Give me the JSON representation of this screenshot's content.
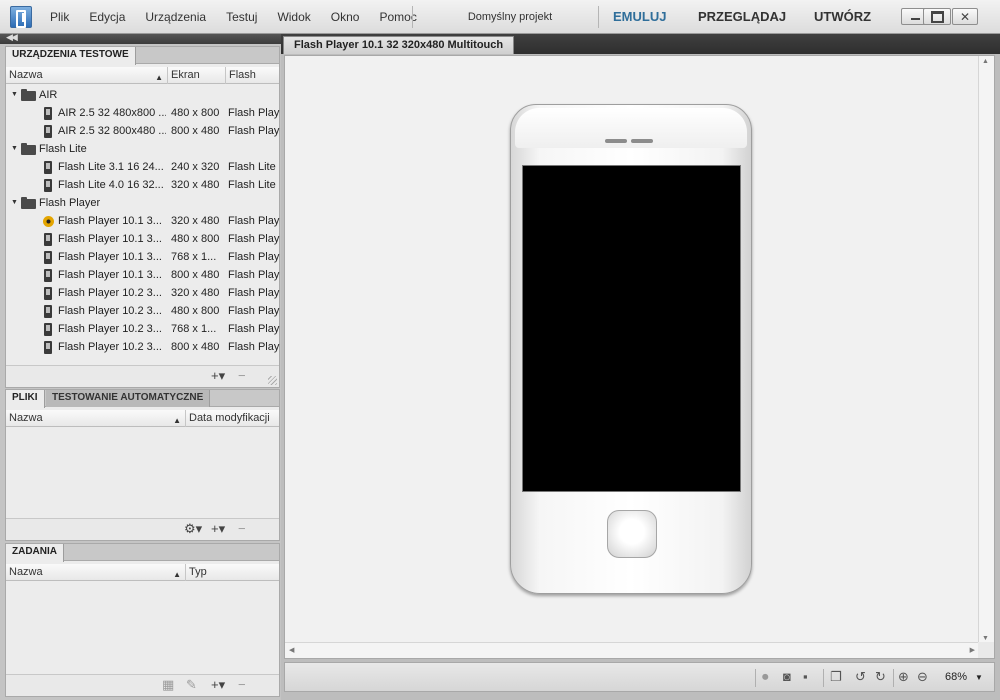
{
  "menu": [
    "Plik",
    "Edycja",
    "Urządzenia",
    "Testuj",
    "Widok",
    "Okno",
    "Pomoc"
  ],
  "project": "Domyślny projekt",
  "workspaces": [
    {
      "label": "EMULUJ",
      "active": true
    },
    {
      "label": "PRZEGLĄDAJ",
      "active": false
    },
    {
      "label": "UTWÓRZ",
      "active": false
    }
  ],
  "devices_panel": {
    "tab": "URZĄDZENIA TESTOWE",
    "columns": [
      "Nazwa",
      "Ekran",
      "Flash"
    ],
    "groups": [
      {
        "name": "AIR",
        "devices": [
          {
            "name": "AIR 2.5 32 480x800 ...",
            "screen": "480 x 800",
            "flash": "Flash Play"
          },
          {
            "name": "AIR 2.5 32 800x480 ...",
            "screen": "800 x 480",
            "flash": "Flash Play"
          }
        ]
      },
      {
        "name": "Flash Lite",
        "devices": [
          {
            "name": "Flash Lite 3.1 16 24...",
            "screen": "240 x 320",
            "flash": "Flash Lite"
          },
          {
            "name": "Flash Lite 4.0 16 32...",
            "screen": "320 x 480",
            "flash": "Flash Lite"
          }
        ]
      },
      {
        "name": "Flash Player",
        "devices": [
          {
            "name": "Flash Player 10.1 3...",
            "screen": "320 x 480",
            "flash": "Flash Play",
            "selected": true
          },
          {
            "name": "Flash Player 10.1 3...",
            "screen": "480 x 800",
            "flash": "Flash Play"
          },
          {
            "name": "Flash Player 10.1 3...",
            "screen": "768 x 1...",
            "flash": "Flash Play"
          },
          {
            "name": "Flash Player 10.1 3...",
            "screen": "800 x 480",
            "flash": "Flash Play"
          },
          {
            "name": "Flash Player 10.2 3...",
            "screen": "320 x 480",
            "flash": "Flash Play"
          },
          {
            "name": "Flash Player 10.2 3...",
            "screen": "480 x 800",
            "flash": "Flash Play"
          },
          {
            "name": "Flash Player 10.2 3...",
            "screen": "768 x 1...",
            "flash": "Flash Play"
          },
          {
            "name": "Flash Player 10.2 3...",
            "screen": "800 x 480",
            "flash": "Flash Play"
          }
        ]
      }
    ],
    "footer": {
      "add": "+▾",
      "remove": "−"
    }
  },
  "files_panel": {
    "tabs": [
      "PLIKI",
      "TESTOWANIE AUTOMATYCZNE"
    ],
    "columns": [
      "Nazwa",
      "Data modyfikacji"
    ],
    "footer": {
      "gear": "⚙▾",
      "add": "+▾",
      "remove": "−"
    }
  },
  "tasks_panel": {
    "tab": "ZADANIA",
    "columns": [
      "Nazwa",
      "Typ"
    ],
    "footer": {
      "add": "+▾",
      "remove": "−"
    }
  },
  "document": {
    "tab": "Flash Player 10.1 32 320x480 Multitouch"
  },
  "statusbar": {
    "zoom": "68%"
  },
  "colors": {
    "accent": "#2f6e9a",
    "screen": "#000000"
  }
}
